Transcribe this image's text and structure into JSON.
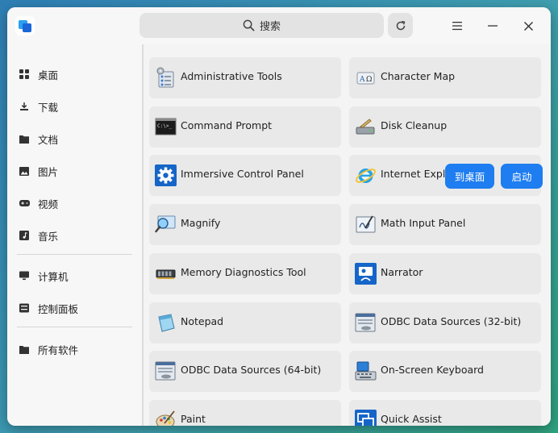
{
  "search": {
    "label": "搜索"
  },
  "sidebar": {
    "items": [
      {
        "label": "桌面",
        "icon": "grid-icon"
      },
      {
        "label": "下载",
        "icon": "download-icon"
      },
      {
        "label": "文档",
        "icon": "folder-icon"
      },
      {
        "label": "图片",
        "icon": "image-icon"
      },
      {
        "label": "视频",
        "icon": "gamepad-icon"
      },
      {
        "label": "音乐",
        "icon": "music-icon"
      },
      {
        "label": "计算机",
        "icon": "monitor-icon"
      },
      {
        "label": "控制面板",
        "icon": "control-panel-icon"
      },
      {
        "label": "所有软件",
        "icon": "folder-icon"
      }
    ]
  },
  "apps": [
    {
      "label": "Administrative Tools",
      "icon": "admin-tools-icon"
    },
    {
      "label": "Character Map",
      "icon": "character-map-icon"
    },
    {
      "label": "Command Prompt",
      "icon": "command-prompt-icon"
    },
    {
      "label": "Disk Cleanup",
      "icon": "disk-cleanup-icon"
    },
    {
      "label": "Immersive Control Panel",
      "icon": "gear-icon"
    },
    {
      "label": "Internet Expl",
      "icon": "internet-explorer-icon"
    },
    {
      "label": "Magnify",
      "icon": "magnifier-icon"
    },
    {
      "label": "Math Input Panel",
      "icon": "math-input-icon"
    },
    {
      "label": "Memory Diagnostics Tool",
      "icon": "memory-chip-icon"
    },
    {
      "label": "Narrator",
      "icon": "narrator-icon"
    },
    {
      "label": "Notepad",
      "icon": "notepad-icon"
    },
    {
      "label": "ODBC Data Sources (32-bit)",
      "icon": "odbc-icon"
    },
    {
      "label": "ODBC Data Sources (64-bit)",
      "icon": "odbc-icon"
    },
    {
      "label": "On-Screen Keyboard",
      "icon": "keyboard-icon"
    },
    {
      "label": "Paint",
      "icon": "paint-palette-icon"
    },
    {
      "label": "Quick Assist",
      "icon": "quick-assist-icon"
    }
  ],
  "actions": {
    "to_desktop": "到桌面",
    "launch": "启动"
  },
  "colors": {
    "accent": "#1e7df0"
  }
}
